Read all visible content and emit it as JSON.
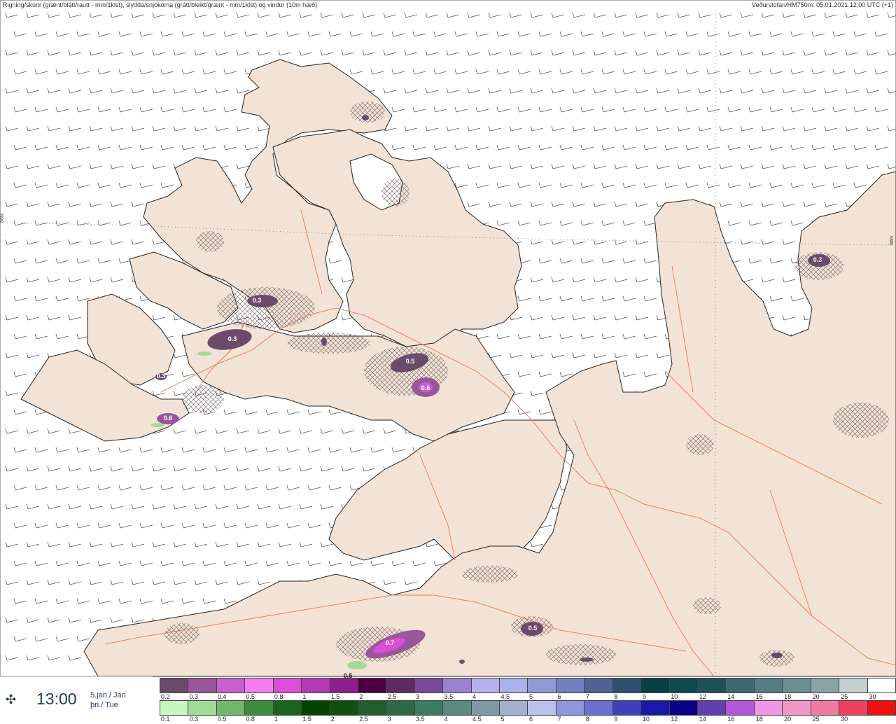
{
  "header": {
    "title": "Rigning/skúrir (grænt/blátt/rautt - mm/1klst), slydda/snjókoma (grátt/bleikt/grænt - mm/1klst) og vindur (10m hæð)",
    "source": "Veðurstofan/HM750m: 05.01.2021 12:00 UTC (+1)"
  },
  "latitude_label": "66N",
  "time": {
    "icon": "move-icon",
    "value": "13:00",
    "date_line1": "5.jan./ Jan",
    "date_line2": "þri./ Tue"
  },
  "map_labels": [
    {
      "text": "0.3"
    },
    {
      "text": "0.3"
    },
    {
      "text": "0.3"
    },
    {
      "text": "0.6"
    },
    {
      "text": "0.5"
    },
    {
      "text": "0.6"
    },
    {
      "text": "0.3"
    },
    {
      "text": "0.5"
    },
    {
      "text": "0.7"
    },
    {
      "text": "0.5"
    }
  ],
  "legend_snow": {
    "colors": [
      "#6b4a6b",
      "#98579a",
      "#c95fcf",
      "#f27ef2",
      "#d94fd5",
      "#b43ab4",
      "#8f1f8d",
      "#4d0040",
      "#5e2a62",
      "#7a4a9a",
      "#9a80d0",
      "#b8b0ee",
      "#a9b2ea",
      "#8e99d6",
      "#6f7fbf",
      "#4f6396",
      "#2f5070",
      "#073e48",
      "#0f4850",
      "#1f5258",
      "#3d6a70",
      "#547e82",
      "#6c8e92",
      "#8aa4a6",
      "#c4cfd1",
      "#ffffff"
    ],
    "labels": [
      "0.2",
      "0.3",
      "0.4",
      "0.5",
      "0.8",
      "1",
      "1.5",
      "2",
      "2.5",
      "3",
      "3.5",
      "4",
      "4.5",
      "5",
      "6",
      "7",
      "8",
      "9",
      "10",
      "12",
      "14",
      "16",
      "18",
      "20",
      "25",
      "30"
    ]
  },
  "legend_rain": {
    "colors": [
      "#c8f5c0",
      "#a0dc98",
      "#6fb86a",
      "#3b8d3b",
      "#1a6420",
      "#044400",
      "#0f5010",
      "#225e2c",
      "#2f6a44",
      "#3d7a62",
      "#5a8a80",
      "#7d9aa4",
      "#a2b0cc",
      "#b8c2ec",
      "#8e96de",
      "#6a70d2",
      "#3e40be",
      "#1a1aa8",
      "#0a0088",
      "#6040b0",
      "#b058d8",
      "#f096e6",
      "#f296c8",
      "#f27aa0",
      "#f04060",
      "#ee1010"
    ],
    "labels": [
      "0.1",
      "0.3",
      "0.5",
      "0.8",
      "1",
      "1.5",
      "2",
      "2.5",
      "3",
      "3.5",
      "4",
      "4.5",
      "5",
      "6",
      "7",
      "8",
      "9",
      "10",
      "12",
      "14",
      "16",
      "18",
      "20",
      "25",
      "30"
    ]
  }
}
